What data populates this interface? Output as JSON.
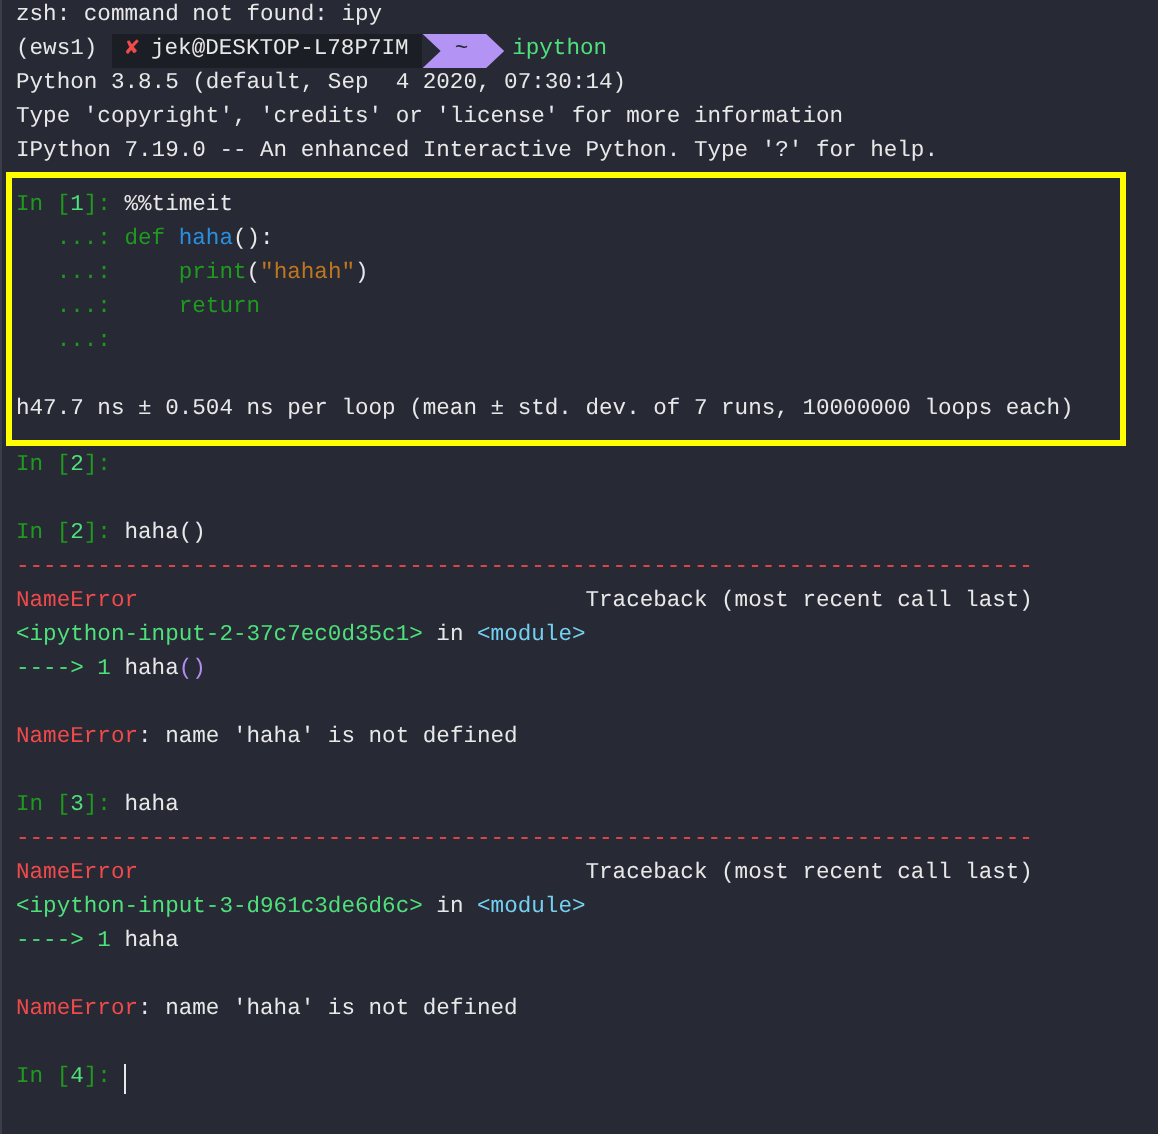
{
  "terminal": {
    "pre_lines": [
      {
        "kind": "text",
        "segments": [
          {
            "text": "zsh: command not found: ipy",
            "kind": "plain"
          }
        ]
      },
      {
        "kind": "shell_prompt",
        "env": "(ews1)",
        "status": "✘",
        "user": "jek@DESKTOP-L78P7IM",
        "cwd": "~",
        "command": "ipython"
      },
      {
        "kind": "text",
        "segments": [
          {
            "text": "Python 3.8.5 (default, Sep  4 2020, 07:30:14)",
            "kind": "plain"
          }
        ]
      },
      {
        "kind": "text",
        "segments": [
          {
            "text": "Type 'copyright', 'credits' or 'license' for more information",
            "kind": "plain"
          }
        ]
      },
      {
        "kind": "text",
        "segments": [
          {
            "text": "IPython 7.19.0 -- An enhanced Interactive Python. Type '?' for help.",
            "kind": "plain"
          }
        ]
      }
    ],
    "highlight_box": {
      "lines": [
        {
          "kind": "text",
          "segments": [
            {
              "text": "In [",
              "kind": "prompt"
            },
            {
              "text": "1",
              "kind": "prompt_num"
            },
            {
              "text": "]: ",
              "kind": "prompt"
            },
            {
              "text": "%%timeit",
              "kind": "plain"
            }
          ]
        },
        {
          "kind": "text",
          "segments": [
            {
              "text": "   ...: ",
              "kind": "prompt"
            },
            {
              "text": "def ",
              "kind": "keyword"
            },
            {
              "text": "haha",
              "kind": "function"
            },
            {
              "text": "():",
              "kind": "plain"
            }
          ]
        },
        {
          "kind": "text",
          "segments": [
            {
              "text": "   ...:     ",
              "kind": "prompt"
            },
            {
              "text": "print",
              "kind": "keyword"
            },
            {
              "text": "(",
              "kind": "plain"
            },
            {
              "text": "\"hahah\"",
              "kind": "string"
            },
            {
              "text": ")",
              "kind": "plain"
            }
          ]
        },
        {
          "kind": "text",
          "segments": [
            {
              "text": "   ...:     ",
              "kind": "prompt"
            },
            {
              "text": "return",
              "kind": "keyword"
            }
          ]
        },
        {
          "kind": "text",
          "segments": [
            {
              "text": "   ...:",
              "kind": "prompt"
            }
          ]
        },
        {
          "kind": "blank"
        },
        {
          "kind": "text",
          "segments": [
            {
              "text": "h47.7 ns ± 0.504 ns per loop (mean ± std. dev. of 7 runs, 10000000 loops each)",
              "kind": "plain"
            }
          ]
        }
      ]
    },
    "post_lines": [
      {
        "kind": "text",
        "segments": [
          {
            "text": "In [",
            "kind": "prompt"
          },
          {
            "text": "2",
            "kind": "prompt_num"
          },
          {
            "text": "]:",
            "kind": "prompt"
          }
        ]
      },
      {
        "kind": "blank"
      },
      {
        "kind": "text",
        "segments": [
          {
            "text": "In [",
            "kind": "prompt"
          },
          {
            "text": "2",
            "kind": "prompt_num"
          },
          {
            "text": "]: ",
            "kind": "prompt"
          },
          {
            "text": "haha()",
            "kind": "plain"
          }
        ]
      },
      {
        "kind": "text",
        "segments": [
          {
            "text": "---------------------------------------------------------------------------",
            "kind": "error"
          }
        ]
      },
      {
        "kind": "text",
        "segments": [
          {
            "text": "NameError",
            "kind": "error"
          },
          {
            "text": "                                 Traceback (most recent call last)",
            "kind": "plain"
          }
        ]
      },
      {
        "kind": "text",
        "segments": [
          {
            "text": "<ipython-input-2-37c7ec0d35c1>",
            "kind": "path"
          },
          {
            "text": " in ",
            "kind": "plain"
          },
          {
            "text": "<module>",
            "kind": "module"
          }
        ]
      },
      {
        "kind": "text",
        "segments": [
          {
            "text": "----> 1 ",
            "kind": "path"
          },
          {
            "text": "haha",
            "kind": "plain"
          },
          {
            "text": "()",
            "kind": "paren"
          }
        ]
      },
      {
        "kind": "blank"
      },
      {
        "kind": "text",
        "segments": [
          {
            "text": "NameError",
            "kind": "error"
          },
          {
            "text": ": name 'haha' is not defined",
            "kind": "plain"
          }
        ]
      },
      {
        "kind": "blank"
      },
      {
        "kind": "text",
        "segments": [
          {
            "text": "In [",
            "kind": "prompt"
          },
          {
            "text": "3",
            "kind": "prompt_num"
          },
          {
            "text": "]: ",
            "kind": "prompt"
          },
          {
            "text": "haha",
            "kind": "plain"
          }
        ]
      },
      {
        "kind": "text",
        "segments": [
          {
            "text": "---------------------------------------------------------------------------",
            "kind": "error"
          }
        ]
      },
      {
        "kind": "text",
        "segments": [
          {
            "text": "NameError",
            "kind": "error"
          },
          {
            "text": "                                 Traceback (most recent call last)",
            "kind": "plain"
          }
        ]
      },
      {
        "kind": "text",
        "segments": [
          {
            "text": "<ipython-input-3-d961c3de6d6c>",
            "kind": "path"
          },
          {
            "text": " in ",
            "kind": "plain"
          },
          {
            "text": "<module>",
            "kind": "module"
          }
        ]
      },
      {
        "kind": "text",
        "segments": [
          {
            "text": "----> 1 ",
            "kind": "path"
          },
          {
            "text": "haha",
            "kind": "plain"
          }
        ]
      },
      {
        "kind": "blank"
      },
      {
        "kind": "text",
        "segments": [
          {
            "text": "NameError",
            "kind": "error"
          },
          {
            "text": ": name 'haha' is not defined",
            "kind": "plain"
          }
        ]
      },
      {
        "kind": "blank"
      },
      {
        "kind": "text",
        "cursor": true,
        "segments": [
          {
            "text": "In [",
            "kind": "prompt"
          },
          {
            "text": "4",
            "kind": "prompt_num"
          },
          {
            "text": "]: ",
            "kind": "prompt"
          }
        ]
      }
    ]
  }
}
